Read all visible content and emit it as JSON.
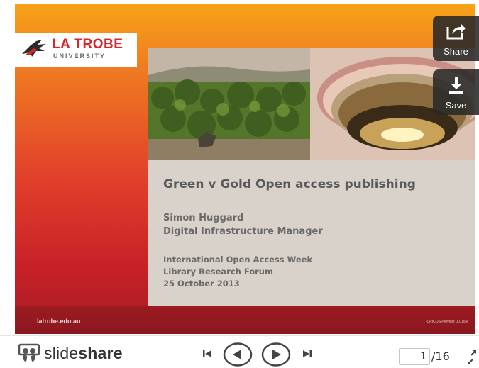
{
  "slide": {
    "logo_title": "LA TROBE",
    "logo_subtitle": "UNIVERSITY",
    "title": "Green v Gold Open access publishing",
    "author_name": "Simon Huggard",
    "author_role": "Digital Infrastructure Manager",
    "event_line1": "International Open Access Week",
    "event_line2": "Library Research Forum",
    "event_date": "25 October 2013",
    "footer_url": "latrobe.edu.au",
    "footer_cricos": "CRICOS Provider 00115M"
  },
  "overlay": {
    "share_label": "Share",
    "save_label": "Save"
  },
  "toolbar": {
    "brand_light": "slide",
    "brand_bold": "share",
    "page_current": "1",
    "page_total": "/16"
  },
  "icons": {
    "share": "share-icon",
    "save": "download-icon",
    "first": "skip-first-icon",
    "prev": "previous-icon",
    "next": "next-icon",
    "last": "skip-last-icon",
    "fullscreen": "fullscreen-icon"
  },
  "colors": {
    "brand_red": "#d8262a",
    "slide_orange": "#f7a218",
    "slide_red": "#c92328",
    "overlay_dark": "#282828"
  }
}
